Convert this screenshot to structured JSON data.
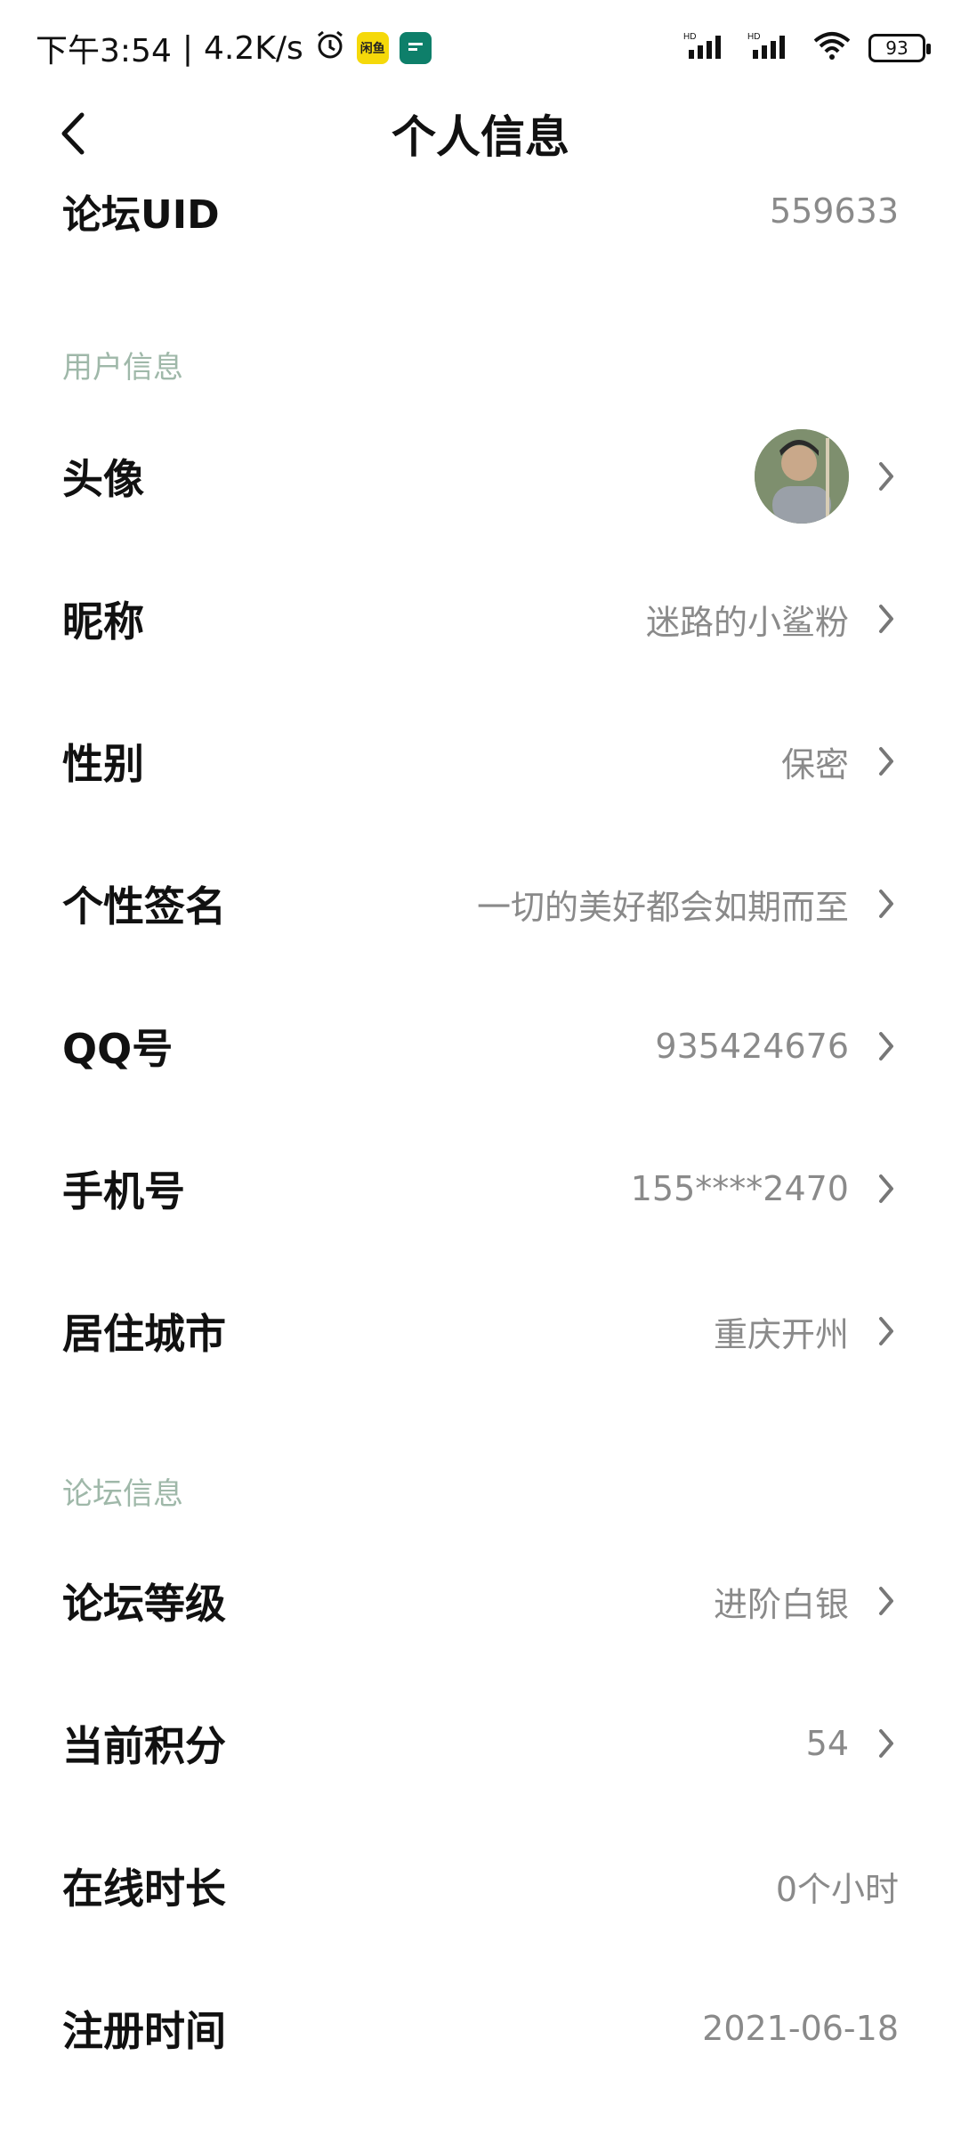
{
  "status_bar": {
    "time": "下午3:54",
    "separator": "|",
    "network_speed": "4.2K/s",
    "app1_label": "闲鱼",
    "battery": "93"
  },
  "header": {
    "title": "个人信息"
  },
  "partial": {
    "label": "论坛UID",
    "value": "559633"
  },
  "sections": {
    "user_info": "用户信息",
    "forum_info": "论坛信息"
  },
  "user_info": [
    {
      "label": "头像",
      "value": ""
    },
    {
      "label": "昵称",
      "value": "迷路的小鲨粉"
    },
    {
      "label": "性别",
      "value": "保密"
    },
    {
      "label": "个性签名",
      "value": "一切的美好都会如期而至"
    },
    {
      "label": "QQ号",
      "value": "935424676"
    },
    {
      "label": "手机号",
      "value": "155****2470"
    },
    {
      "label": "居住城市",
      "value": "重庆开州"
    }
  ],
  "forum_info": [
    {
      "label": "论坛等级",
      "value": "进阶白银"
    },
    {
      "label": "当前积分",
      "value": "54"
    },
    {
      "label": "在线时长",
      "value": "0个小时"
    },
    {
      "label": "注册时间",
      "value": "2021-06-18"
    }
  ],
  "colors": {
    "section_header": "#9fb8a9",
    "value_text": "#8a8a8a"
  }
}
